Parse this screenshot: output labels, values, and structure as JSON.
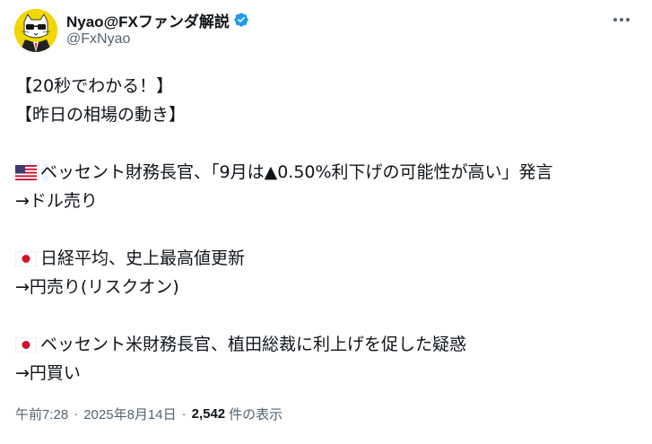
{
  "author": {
    "display_name": "Nyao@FXファンダ解説",
    "handle": "@FxNyao",
    "verified_icon": "verified-badge-icon",
    "colors": {
      "verified": "#1d9bf0",
      "avatar_bg": "#f2d600"
    }
  },
  "tweet": {
    "lines": [
      "【20秒でわかる！】",
      "【昨日の相場の動き】",
      "",
      "ベッセント財務長官、「9月は▲0.50%利下げの可能性が高い」発言",
      "→ドル売り",
      "",
      "日経平均、史上最高値更新",
      "→円売り(リスクオン)",
      "",
      "ベッセント米財務長官、植田総裁に利上げを促した疑惑",
      "→円買い"
    ],
    "flags": {
      "us": "us-flag-icon",
      "jp": "japan-flag-icon"
    }
  },
  "meta": {
    "time": "午前7:28",
    "separator": "·",
    "date": "2025年8月14日",
    "views_count": "2,542",
    "views_label": "件の表示"
  }
}
